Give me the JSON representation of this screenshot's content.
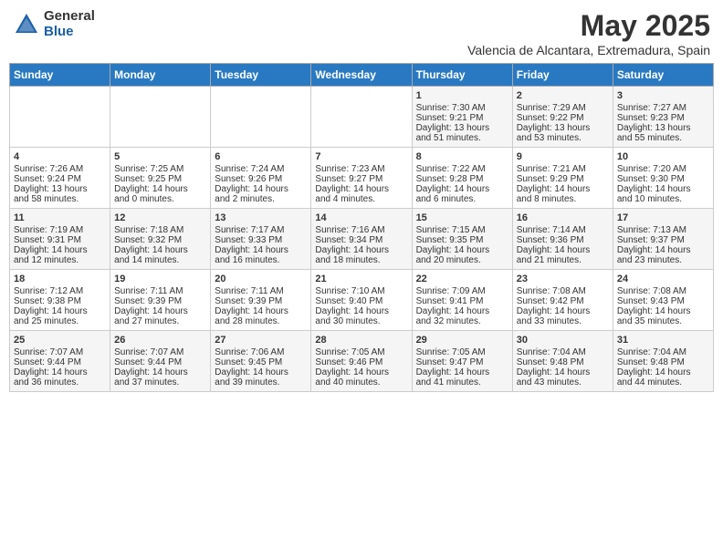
{
  "header": {
    "logo_general": "General",
    "logo_blue": "Blue",
    "title": "May 2025",
    "subtitle": "Valencia de Alcantara, Extremadura, Spain"
  },
  "calendar": {
    "days_of_week": [
      "Sunday",
      "Monday",
      "Tuesday",
      "Wednesday",
      "Thursday",
      "Friday",
      "Saturday"
    ],
    "weeks": [
      [
        {
          "day": "",
          "content": ""
        },
        {
          "day": "",
          "content": ""
        },
        {
          "day": "",
          "content": ""
        },
        {
          "day": "",
          "content": ""
        },
        {
          "day": "1",
          "content": "Sunrise: 7:30 AM\nSunset: 9:21 PM\nDaylight: 13 hours\nand 51 minutes."
        },
        {
          "day": "2",
          "content": "Sunrise: 7:29 AM\nSunset: 9:22 PM\nDaylight: 13 hours\nand 53 minutes."
        },
        {
          "day": "3",
          "content": "Sunrise: 7:27 AM\nSunset: 9:23 PM\nDaylight: 13 hours\nand 55 minutes."
        }
      ],
      [
        {
          "day": "4",
          "content": "Sunrise: 7:26 AM\nSunset: 9:24 PM\nDaylight: 13 hours\nand 58 minutes."
        },
        {
          "day": "5",
          "content": "Sunrise: 7:25 AM\nSunset: 9:25 PM\nDaylight: 14 hours\nand 0 minutes."
        },
        {
          "day": "6",
          "content": "Sunrise: 7:24 AM\nSunset: 9:26 PM\nDaylight: 14 hours\nand 2 minutes."
        },
        {
          "day": "7",
          "content": "Sunrise: 7:23 AM\nSunset: 9:27 PM\nDaylight: 14 hours\nand 4 minutes."
        },
        {
          "day": "8",
          "content": "Sunrise: 7:22 AM\nSunset: 9:28 PM\nDaylight: 14 hours\nand 6 minutes."
        },
        {
          "day": "9",
          "content": "Sunrise: 7:21 AM\nSunset: 9:29 PM\nDaylight: 14 hours\nand 8 minutes."
        },
        {
          "day": "10",
          "content": "Sunrise: 7:20 AM\nSunset: 9:30 PM\nDaylight: 14 hours\nand 10 minutes."
        }
      ],
      [
        {
          "day": "11",
          "content": "Sunrise: 7:19 AM\nSunset: 9:31 PM\nDaylight: 14 hours\nand 12 minutes."
        },
        {
          "day": "12",
          "content": "Sunrise: 7:18 AM\nSunset: 9:32 PM\nDaylight: 14 hours\nand 14 minutes."
        },
        {
          "day": "13",
          "content": "Sunrise: 7:17 AM\nSunset: 9:33 PM\nDaylight: 14 hours\nand 16 minutes."
        },
        {
          "day": "14",
          "content": "Sunrise: 7:16 AM\nSunset: 9:34 PM\nDaylight: 14 hours\nand 18 minutes."
        },
        {
          "day": "15",
          "content": "Sunrise: 7:15 AM\nSunset: 9:35 PM\nDaylight: 14 hours\nand 20 minutes."
        },
        {
          "day": "16",
          "content": "Sunrise: 7:14 AM\nSunset: 9:36 PM\nDaylight: 14 hours\nand 21 minutes."
        },
        {
          "day": "17",
          "content": "Sunrise: 7:13 AM\nSunset: 9:37 PM\nDaylight: 14 hours\nand 23 minutes."
        }
      ],
      [
        {
          "day": "18",
          "content": "Sunrise: 7:12 AM\nSunset: 9:38 PM\nDaylight: 14 hours\nand 25 minutes."
        },
        {
          "day": "19",
          "content": "Sunrise: 7:11 AM\nSunset: 9:39 PM\nDaylight: 14 hours\nand 27 minutes."
        },
        {
          "day": "20",
          "content": "Sunrise: 7:11 AM\nSunset: 9:39 PM\nDaylight: 14 hours\nand 28 minutes."
        },
        {
          "day": "21",
          "content": "Sunrise: 7:10 AM\nSunset: 9:40 PM\nDaylight: 14 hours\nand 30 minutes."
        },
        {
          "day": "22",
          "content": "Sunrise: 7:09 AM\nSunset: 9:41 PM\nDaylight: 14 hours\nand 32 minutes."
        },
        {
          "day": "23",
          "content": "Sunrise: 7:08 AM\nSunset: 9:42 PM\nDaylight: 14 hours\nand 33 minutes."
        },
        {
          "day": "24",
          "content": "Sunrise: 7:08 AM\nSunset: 9:43 PM\nDaylight: 14 hours\nand 35 minutes."
        }
      ],
      [
        {
          "day": "25",
          "content": "Sunrise: 7:07 AM\nSunset: 9:44 PM\nDaylight: 14 hours\nand 36 minutes."
        },
        {
          "day": "26",
          "content": "Sunrise: 7:07 AM\nSunset: 9:44 PM\nDaylight: 14 hours\nand 37 minutes."
        },
        {
          "day": "27",
          "content": "Sunrise: 7:06 AM\nSunset: 9:45 PM\nDaylight: 14 hours\nand 39 minutes."
        },
        {
          "day": "28",
          "content": "Sunrise: 7:05 AM\nSunset: 9:46 PM\nDaylight: 14 hours\nand 40 minutes."
        },
        {
          "day": "29",
          "content": "Sunrise: 7:05 AM\nSunset: 9:47 PM\nDaylight: 14 hours\nand 41 minutes."
        },
        {
          "day": "30",
          "content": "Sunrise: 7:04 AM\nSunset: 9:48 PM\nDaylight: 14 hours\nand 43 minutes."
        },
        {
          "day": "31",
          "content": "Sunrise: 7:04 AM\nSunset: 9:48 PM\nDaylight: 14 hours\nand 44 minutes."
        }
      ]
    ]
  }
}
